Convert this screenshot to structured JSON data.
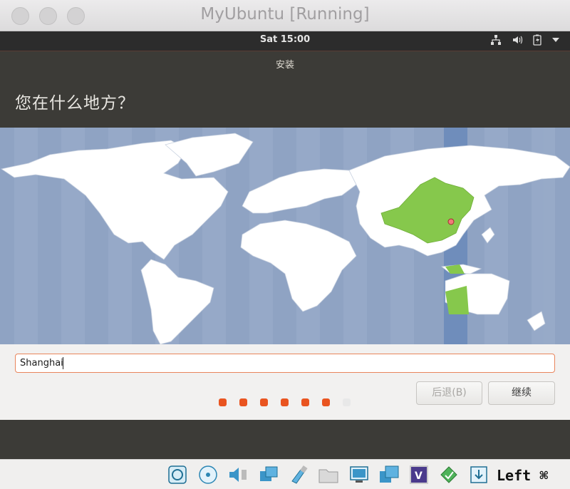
{
  "window": {
    "title": "MyUbuntu [Running]"
  },
  "panel": {
    "clock": "Sat 15:00",
    "icons": [
      "network-icon",
      "volume-icon",
      "battery-icon",
      "menu-arrow-icon"
    ]
  },
  "installer": {
    "title": "安装",
    "question": "您在什么地方？",
    "location": {
      "value": "Shanghai"
    },
    "buttons": {
      "back": "后退(B)",
      "continue": "继续"
    },
    "steps": {
      "total": 7,
      "current": 7
    }
  },
  "statusbar": {
    "icons": [
      "hard-disk-icon",
      "optical-drive-icon",
      "audio-icon",
      "network-adapter-icon",
      "usb-icon",
      "shared-folders-icon",
      "display-icon",
      "capture-icon",
      "virtualbox-icon",
      "mouse-integration-icon",
      "keyboard-capture-icon"
    ],
    "host_key": "Left ⌘"
  },
  "colors": {
    "accent": "#e95420",
    "map_water": "#8fa3c3",
    "highlight_region": "#86c84c"
  }
}
